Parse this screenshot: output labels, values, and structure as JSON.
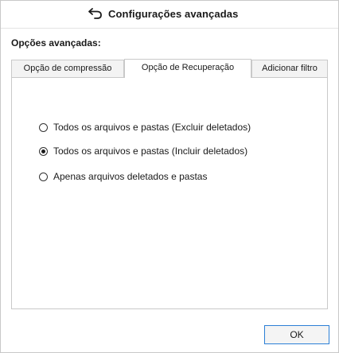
{
  "window": {
    "title": "Configurações avançadas",
    "title_icon": "back-arrow-icon"
  },
  "section": {
    "label": "Opções avançadas:"
  },
  "tabs": [
    {
      "label": "Opção de compressão",
      "selected": false
    },
    {
      "label": "Opção de Recuperação",
      "selected": true
    },
    {
      "label": "Adicionar filtro",
      "selected": false
    }
  ],
  "recovery_options": [
    {
      "label": "Todos os arquivos e pastas (Excluir deletados)",
      "checked": false
    },
    {
      "label": "Todos os arquivos e pastas (Incluir deletados)",
      "checked": true
    },
    {
      "label": "Apenas arquivos deletados e pastas",
      "checked": false
    }
  ],
  "footer": {
    "ok_label": "OK"
  },
  "colors": {
    "accent": "#2b7fd6",
    "border": "#c9c9c9"
  }
}
